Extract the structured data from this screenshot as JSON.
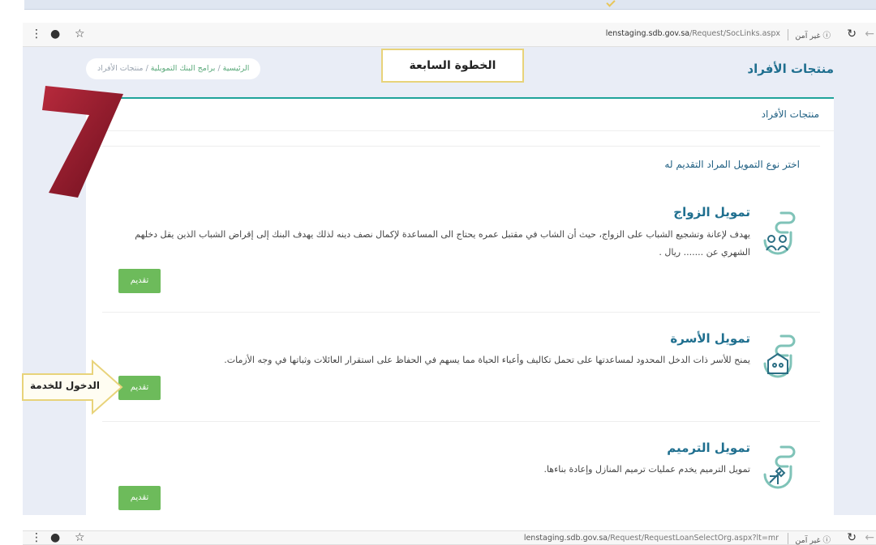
{
  "browser_top": {
    "url_host": "lenstaging.sdb.gov.sa",
    "url_path": "/Request/SocLinks.aspx",
    "security_label": "غير آمن"
  },
  "browser_bottom": {
    "url_host": "lenstaging.sdb.gov.sa",
    "url_path": "/Request/RequestLoanSelectOrg.aspx?lt=mr",
    "security_label": "غير آمن"
  },
  "header": {
    "page_title": "منتجات الأفراد",
    "breadcrumb": {
      "home": "الرئيسية",
      "sep": "/",
      "programs": "برامج البنك التمويلية",
      "current": "منتجات الأفراد"
    }
  },
  "annotations": {
    "step_label": "الخطوة السابعة",
    "step_number": "7",
    "service_entry_label": "الدخول للخدمة"
  },
  "card": {
    "title": "منتجات الأفراد",
    "subtitle": "اختر نوع التمويل المراد التقديم له"
  },
  "products": [
    {
      "title": "تمويل الزواج",
      "description": "يهدف لإعانة وتشجيع الشباب على الزواج، حيث أن الشاب في مقتبل عمره يحتاج الى المساعدة لإكمال نصف دينه لذلك يهدف البنك إلى إقراض الشباب الذين يقل دخلهم الشهري عن ....... ريال .",
      "apply_label": "تقديم",
      "icon": "marriage-icon"
    },
    {
      "title": "تمويل الأسرة",
      "description": "يمنح للأسر ذات الدخل المحدود لمساعدتها على تحمل تكاليف وأعباء الحياة مما يسهم في الحفاظ على استقرار العائلات وثباتها في وجه الأزمات.",
      "apply_label": "تقديم",
      "icon": "family-icon"
    },
    {
      "title": "تمويل الترميم",
      "description": "تمويل الترميم يخدم عمليات ترميم المنازل وإعادة بناءها.",
      "apply_label": "تقديم",
      "icon": "renovation-icon"
    }
  ],
  "colors": {
    "accent_teal": "#1fa39a",
    "title_blue": "#1f6f8f",
    "button_green": "#6dbb5b",
    "seven_red": "#8b1a2a",
    "highlight_yellow": "#e8d37a"
  }
}
